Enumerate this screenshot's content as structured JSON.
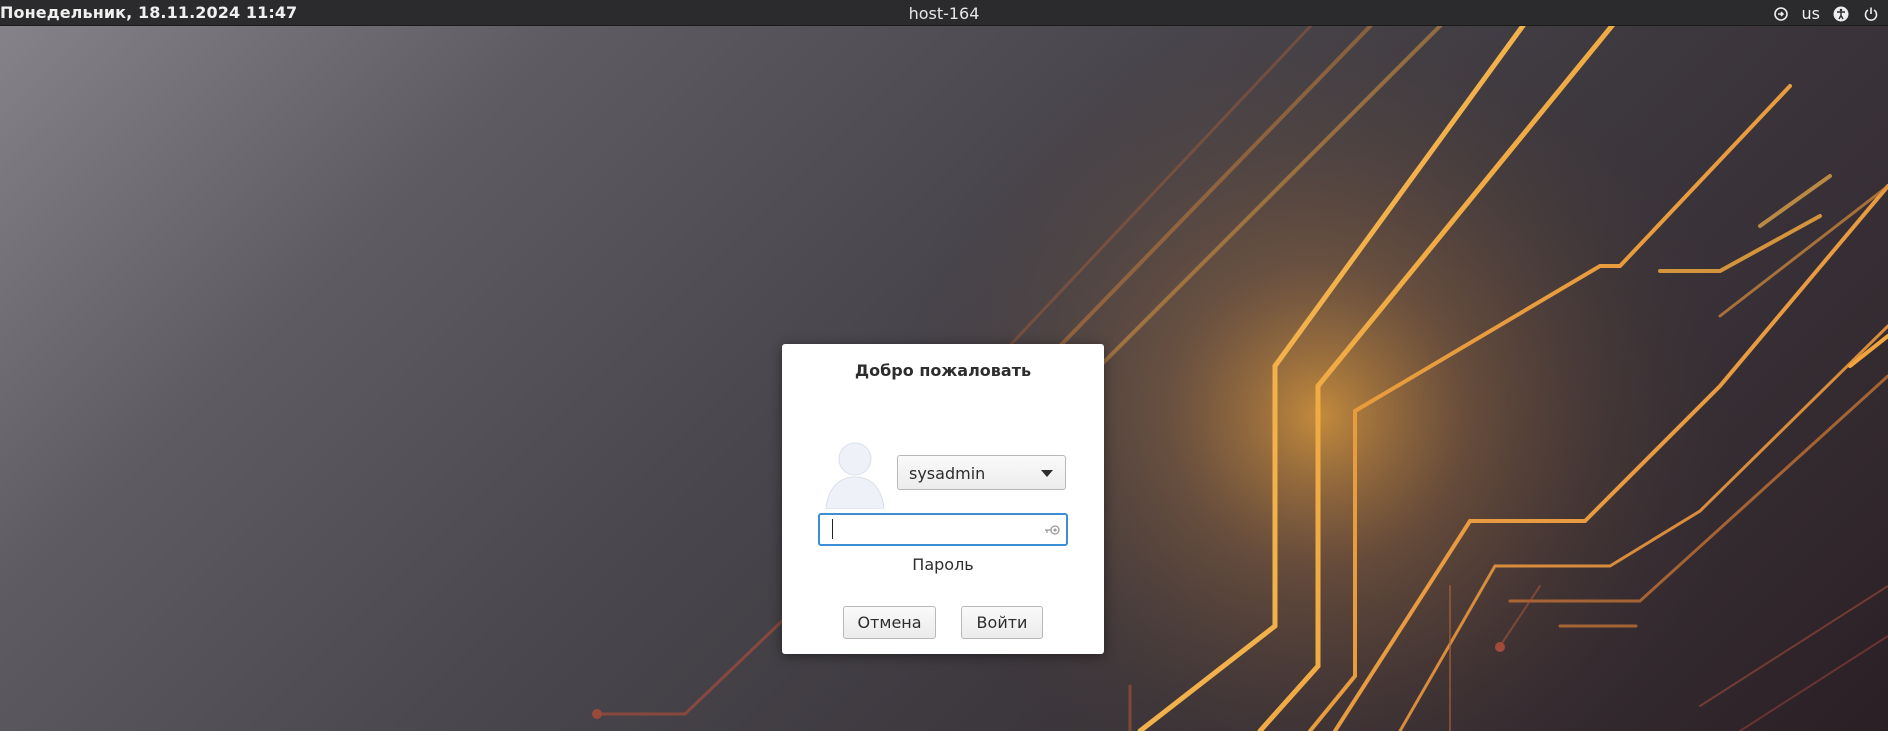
{
  "topbar": {
    "datetime": "Понедельник, 18.11.2024 11:47",
    "hostname": "host-164",
    "keyboard_layout": "us",
    "icons": [
      "session-icon",
      "accessibility-icon",
      "power-icon"
    ]
  },
  "dialog": {
    "title": "Добро пожаловать",
    "user": {
      "selected": "sysadmin"
    },
    "password": {
      "value": "",
      "label": "Пароль"
    },
    "buttons": {
      "cancel": "Отмена",
      "login": "Войти"
    }
  },
  "colors": {
    "topbar_bg": "#2b2b2d",
    "focus_accent": "#3c8fd6",
    "wallpaper_glow": "#f0a63c"
  }
}
